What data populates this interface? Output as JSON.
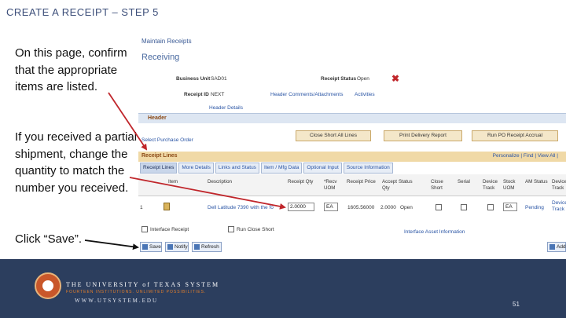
{
  "slide": {
    "title": "CREATE A RECEIPT – STEP 5",
    "instruction_1": "On this page, confirm that the appropriate items are listed.",
    "instruction_2": "If you received a partial shipment, change the quantity to match the number you received.",
    "instruction_3": "Click “Save”.",
    "page_number": "51"
  },
  "footer": {
    "university": "THE UNIVERSITY of TEXAS SYSTEM",
    "tagline": "FOURTEEN INSTITUTIONS. UNLIMITED POSSIBILITIES.",
    "website": "WWW.UTSYSTEM.EDU"
  },
  "peoplesoft": {
    "breadcrumb": "Maintain Receipts",
    "heading": "Receiving",
    "business_unit_label": "Business Unit",
    "business_unit_value": "SAD01",
    "receipt_status_label": "Receipt Status",
    "receipt_status_value": "Open",
    "receipt_id_label": "Receipt ID",
    "receipt_id_value": "NEXT",
    "header_comments_link": "Header Comments/Attachments",
    "activities_link": "Activities",
    "header_details_link": "Header Details",
    "header_section": "Header",
    "select_po_link": "Select Purchase Order",
    "close_short_btn": "Close Short All Lines",
    "print_delivery_btn": "Print Delivery Report",
    "run_po_btn": "Run PO Receipt Accrual",
    "receipt_lines_title": "Receipt Lines",
    "grid_nav": "Personalize | Find | View All |",
    "tabs": [
      "Receipt Lines",
      "More Details",
      "Links and Status",
      "Item / Mfg Data",
      "Optional Input",
      "Source Information"
    ],
    "columns": [
      "Item",
      "Description",
      "Receipt Qty",
      "*Recv UOM",
      "Receipt Price",
      "Accept Qty",
      "Status",
      "Close Short",
      "Serial",
      "Device Track",
      "Stock UOM",
      "AM Status",
      "Device Track"
    ],
    "row": {
      "line": "1",
      "description": "Dell Latitude 7390 with the fo",
      "receipt_qty": "2.0000",
      "recv_uom": "EA",
      "receipt_price": "1605.56000",
      "accept_qty": "2.0000",
      "status": "Open",
      "stock_uom": "EA",
      "am_status": "Pending",
      "device_track": "Device Track"
    },
    "interface_receipt": "Interface Receipt",
    "run_close_short": "Run Close Short",
    "interface_asset_link": "Interface Asset Information",
    "save_btn": "Save",
    "notify_btn": "Notify",
    "refresh_btn": "Refresh",
    "add_btn": "Add"
  },
  "colors": {
    "footer_bg": "#2c3e5e",
    "arrow": "#c0262b",
    "title": "#3d4f7a"
  }
}
